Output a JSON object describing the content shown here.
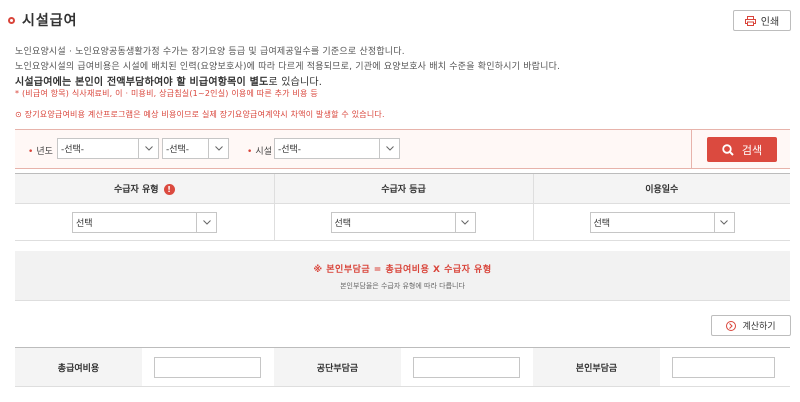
{
  "header": {
    "title": "시설급여",
    "print_label": "인쇄"
  },
  "description": {
    "line1": "노인요양시설 · 노인요양공동생활가정 수가는 장기요양 등급 및 급여제공일수를 기준으로 산정합니다.",
    "line2": "노인요양시설의 급여비용은 시설에 배치된 인력(요양보호사)에 따라 다르게 적용되므로, 기관에 요양보호사 배치 수준을 확인하시기 바랍니다.",
    "line3_bold": "시설급여에는 본인이 전액부담하여야 할 비급여항목이 별도",
    "line3_rest": "로 있습니다.",
    "line4": "* (비급여 항목) 식사재료비, 이 · 미용비, 상급침실(1~2인실) 이용에 따른 추가 비용 등",
    "notice": "장기요양급여비용 계산프로그램은 예상 비용이므로 실제 장기요양급여계약시 차액이 발생할 수 있습니다."
  },
  "search": {
    "year_label": "년도",
    "year_select": "-선택-",
    "month_select": "-선택-",
    "facility_label": "시설",
    "facility_select": "-선택-",
    "button_label": "검색"
  },
  "table": {
    "headers": [
      "수급자 유형",
      "수급자 등급",
      "이용일수"
    ],
    "info_badge": "!",
    "selects": [
      "선택",
      "선택",
      "선택"
    ]
  },
  "formula": {
    "main": "※ 본인부담금 = 총급여비용 X 수급자 유형",
    "sub": "본인부담율은 수급자 유형에 따라 다릅니다"
  },
  "calculate": {
    "label": "계산하기"
  },
  "results": {
    "labels": [
      "총급여비용",
      "공단부담금",
      "본인부담금"
    ],
    "values": [
      "",
      "",
      ""
    ]
  },
  "colors": {
    "accent": "#db4a3f",
    "search_bg": "#fff8f6",
    "header_bg": "#f4f4f4"
  }
}
